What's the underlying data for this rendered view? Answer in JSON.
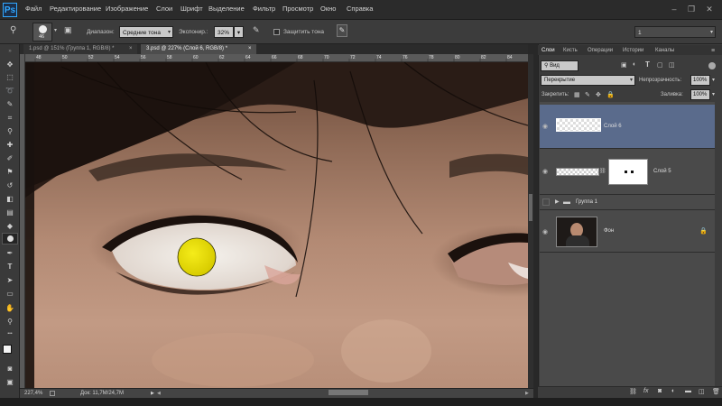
{
  "app": {
    "logo": "Ps"
  },
  "menu": [
    "Файл",
    "Редактирование",
    "Изображение",
    "Слои",
    "Шрифт",
    "Выделение",
    "Фильтр",
    "Просмотр",
    "Окно",
    "Справка"
  ],
  "window_controls": {
    "minimize": "–",
    "restore": "❐",
    "close": "✕"
  },
  "options": {
    "brush_size": "46",
    "range_label": "Диапазон:",
    "range_value": "Средние тона",
    "exposure_label": "Экспонир.:",
    "exposure_value": "32%",
    "protect_tones_label": "Защитить тона",
    "workspace_value": "1"
  },
  "tabs": [
    {
      "label": "1.psd @ 151% (Группа 1, RGB/8) *",
      "active": false,
      "close": "×"
    },
    {
      "label": "3.psd @ 227% (Слой 6, RGB/8) *",
      "active": true,
      "close": "×"
    }
  ],
  "ruler_top_ticks": [
    "48",
    "50",
    "52",
    "54",
    "56",
    "58",
    "60",
    "62",
    "64",
    "66",
    "68",
    "70",
    "72",
    "74",
    "76",
    "78",
    "80",
    "82",
    "84"
  ],
  "status": {
    "zoom": "227,4%",
    "doc": "Док: 11,7M/24,7M",
    "arrow": "▶"
  },
  "panel": {
    "tabs": [
      "Слои",
      "Кисть",
      "Операции",
      "Истории",
      "Каналы"
    ],
    "menu_icon": "≡",
    "filter_kind": "Вид",
    "blend_mode": "Перекрытие",
    "opacity_label": "Непрозрачность:",
    "opacity_value": "100%",
    "lock_label": "Закрепить:",
    "fill_label": "Заливка:",
    "fill_value": "100%",
    "layers": [
      {
        "name": "Слой 6",
        "selected": true,
        "visible": true
      },
      {
        "name": "Слой 5",
        "selected": false,
        "visible": true
      },
      {
        "name": "Группа 1",
        "selected": false,
        "visible": false,
        "group": true
      },
      {
        "name": "Фон",
        "selected": false,
        "visible": true,
        "locked": true
      }
    ]
  },
  "colors": {
    "accent": "#5a6b8c",
    "brush_cursor": "#e8dd00",
    "iris_white": "#f1eeea"
  }
}
